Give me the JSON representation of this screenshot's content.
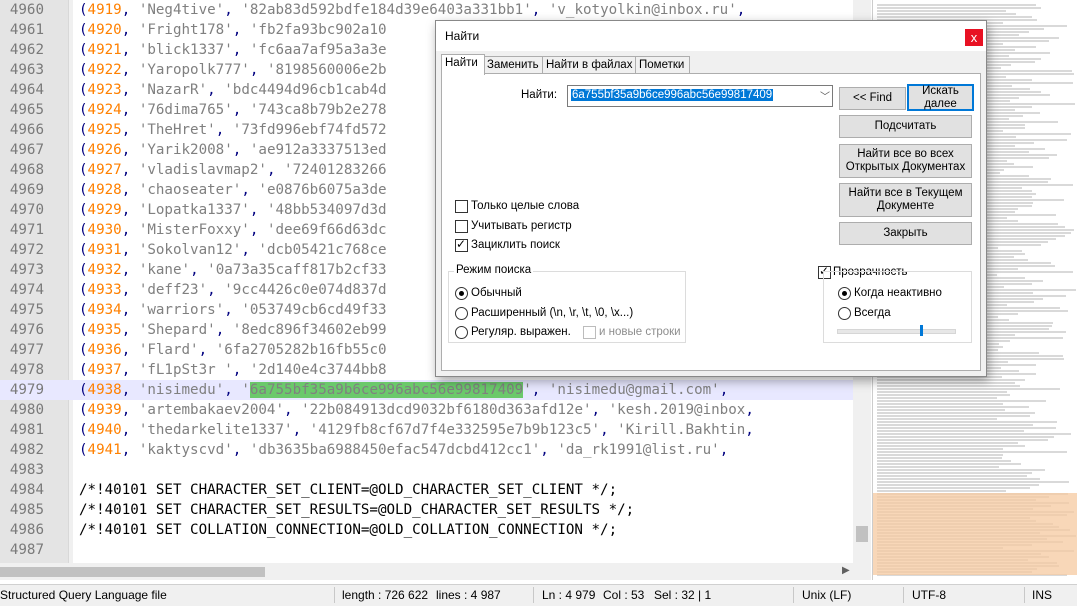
{
  "editor": {
    "lines": [
      {
        "n": "4960",
        "id": "4919",
        "user": "'Neg4tive'",
        "hash": "'82ab83d592bdfe184d39e6403a331bb1'",
        "email": "'v_kotyolkin@inbox.ru'"
      },
      {
        "n": "4961",
        "id": "4920",
        "user": "'Fright178'",
        "hash": "'fb2fa93bc902a10",
        "email": ""
      },
      {
        "n": "4962",
        "id": "4921",
        "user": "'blick1337'",
        "hash": "'fc6aa7af95a3a3e",
        "email": ""
      },
      {
        "n": "4963",
        "id": "4922",
        "user": "'Yaropolk777'",
        "hash": "'8198560006e2b",
        "email": ""
      },
      {
        "n": "4964",
        "id": "4923",
        "user": "'NazarR'",
        "hash": "'bdc4494d96cb1cab4d",
        "email": ""
      },
      {
        "n": "4965",
        "id": "4924",
        "user": "'76dima765'",
        "hash": "'743ca8b79b2e278",
        "email": ""
      },
      {
        "n": "4966",
        "id": "4925",
        "user": "'TheHret'",
        "hash": "'73fd996ebf74fd572",
        "email": ""
      },
      {
        "n": "4967",
        "id": "4926",
        "user": "'Yarik2008'",
        "hash": "'ae912a3337513ed",
        "email": ""
      },
      {
        "n": "4968",
        "id": "4927",
        "user": "'vladislavmap2'",
        "hash": "'72401283266",
        "email": ""
      },
      {
        "n": "4969",
        "id": "4928",
        "user": "'chaoseater'",
        "hash": "'e0876b6075a3de",
        "email": ""
      },
      {
        "n": "4970",
        "id": "4929",
        "user": "'Lopatka1337'",
        "hash": "'48bb534097d3d",
        "email": ""
      },
      {
        "n": "4971",
        "id": "4930",
        "user": "'MisterFoxxy'",
        "hash": "'dee69f66d63dc",
        "email": ""
      },
      {
        "n": "4972",
        "id": "4931",
        "user": "'Sokolvan12'",
        "hash": "'dcb05421c768ce",
        "email": ""
      },
      {
        "n": "4973",
        "id": "4932",
        "user": "'kane'",
        "hash": "'0a73a35caff817b2cf33",
        "email": ""
      },
      {
        "n": "4974",
        "id": "4933",
        "user": "'deff23'",
        "hash": "'9cc4426c0e074d837d",
        "email": ""
      },
      {
        "n": "4975",
        "id": "4934",
        "user": "'warriors'",
        "hash": "'053749cb6cd49f33",
        "email": ""
      },
      {
        "n": "4976",
        "id": "4935",
        "user": "'Shepard'",
        "hash": "'8edc896f34602eb99",
        "email": ""
      },
      {
        "n": "4977",
        "id": "4936",
        "user": "'Flard'",
        "hash": "'6fa2705282b16fb55c0",
        "email": ""
      },
      {
        "n": "4978",
        "id": "4937",
        "user": "'fL1pSt3r '",
        "hash": "'2d140e4c3744bb8",
        "email": ""
      },
      {
        "n": "4979",
        "id": "4938",
        "user": "'nisimedu'",
        "hash": "6a755bf35a9b6ce996abc56e99817409",
        "email": "'nisimedu@gmail.com'",
        "current": true
      },
      {
        "n": "4980",
        "id": "4939",
        "user": "'artembakaev2004'",
        "hash": "'22b084913dcd9032bf6180d363afd12e'",
        "email": "'kesh.2019@inbox"
      },
      {
        "n": "4981",
        "id": "4940",
        "user": "'thedarkelite1337'",
        "hash": "'4129fb8cf67d7f4e332595e7b9b123c5'",
        "email": "'Kirill.Bakhtin"
      },
      {
        "n": "4982",
        "id": "4941",
        "user": "'kaktyscvd'",
        "hash": "'db3635ba6988450efac547dcbd412cc1'",
        "email": "'da_rk1991@list.ru'"
      }
    ],
    "sql_lines": [
      {
        "n": "4983",
        "text": ""
      },
      {
        "n": "4984",
        "text": "/*!40101 SET CHARACTER_SET_CLIENT=@OLD_CHARACTER_SET_CLIENT */;"
      },
      {
        "n": "4985",
        "text": "/*!40101 SET CHARACTER_SET_RESULTS=@OLD_CHARACTER_SET_RESULTS */;"
      },
      {
        "n": "4986",
        "text": "/*!40101 SET COLLATION_CONNECTION=@OLD_COLLATION_CONNECTION */;"
      },
      {
        "n": "4987",
        "text": ""
      }
    ]
  },
  "status": {
    "filetype": "Structured Query Language file",
    "length": "length : 726 622",
    "lines": "lines : 4 987",
    "ln": "Ln : 4 979",
    "col": "Col : 53",
    "sel": "Sel : 32 | 1",
    "eol": "Unix (LF)",
    "encoding": "UTF-8",
    "mode": "INS"
  },
  "dialog": {
    "title": "Найти",
    "close": "x",
    "tabs": [
      "Найти",
      "Заменить",
      "Найти в файлах",
      "Пометки"
    ],
    "find_label": "Найти:",
    "find_value": "6a755bf35a9b6ce996abc56e99817409",
    "buttons": {
      "find_prev": "<< Find",
      "find_next": "Искать далее",
      "count": "Подсчитать",
      "find_all_open": "Найти все во всех Открытых Документах",
      "find_all_current": "Найти все в Текущем Документе",
      "close": "Закрыть"
    },
    "options": {
      "whole_word": "Только целые слова",
      "match_case": "Учитывать регистр",
      "wrap": "Зациклить поиск"
    },
    "search_mode": {
      "title": "Режим поиска",
      "normal": "Обычный",
      "extended": "Расширенный (\\n, \\r, \\t, \\0, \\x...)",
      "regex": "Регуляр. выражен.",
      "newline": "и новые строки"
    },
    "transparency": {
      "title": "Прозрачность",
      "on_lose_focus": "Когда неактивно",
      "always": "Всегда",
      "level": 0.72
    }
  }
}
